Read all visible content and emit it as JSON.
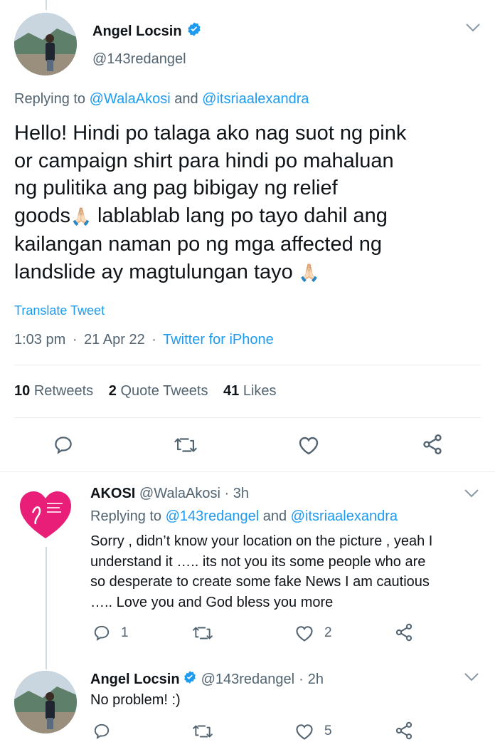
{
  "main_tweet": {
    "name": "Angel Locsin",
    "handle": "@143redangel",
    "replying_prefix": "Replying to",
    "reply_user1": "@WalaAkosi",
    "reply_and": "and",
    "reply_user2": "@itsriaalexandra",
    "text_lines": [
      "Hello! Hindi po talaga ako nag suot ng pink",
      "or campaign shirt para hindi po mahaluan",
      "ng pulitika ang pag bibigay ng relief",
      "goods",
      " lablablab lang po tayo dahil ang",
      "kailangan naman po ng mga affected ng",
      "landslide ay magtulungan tayo "
    ],
    "emoji": "🙏🏻",
    "translate": "Translate Tweet",
    "time": "1:03 pm",
    "date": "21 Apr 22",
    "source": "Twitter for iPhone",
    "retweets_count": "10",
    "retweets_label": "Retweets",
    "quotes_count": "2",
    "quotes_label": "Quote Tweets",
    "likes_count": "41",
    "likes_label": "Likes"
  },
  "reply1": {
    "name": "AKOSI",
    "handle": "@WalaAkosi",
    "time": "3h",
    "replying_prefix": "Replying to",
    "reply_user1": "@143redangel",
    "reply_and": "and",
    "reply_user2": "@itsriaalexandra",
    "text_lines": [
      "Sorry , didn’t know your location on the picture , yeah I",
      "understand it ….. its not you its some people who are",
      "so desperate to create some fake News I am cautious",
      "….. Love you and God bless you more"
    ],
    "reply_count": "1",
    "retweet_count": "",
    "like_count": "2"
  },
  "reply2": {
    "name": "Angel Locsin",
    "handle": "@143redangel",
    "time": "2h",
    "text": "No problem! :)",
    "reply_count": "",
    "retweet_count": "",
    "like_count": "5"
  },
  "separator": "·",
  "colors": {
    "accent": "#1d9bf0",
    "muted": "#536471",
    "text": "#0f1419",
    "avatar_pink": "#e91e78"
  },
  "icons": [
    "reply-icon",
    "retweet-icon",
    "like-icon",
    "share-icon",
    "verified-icon",
    "chevron-down-icon"
  ]
}
